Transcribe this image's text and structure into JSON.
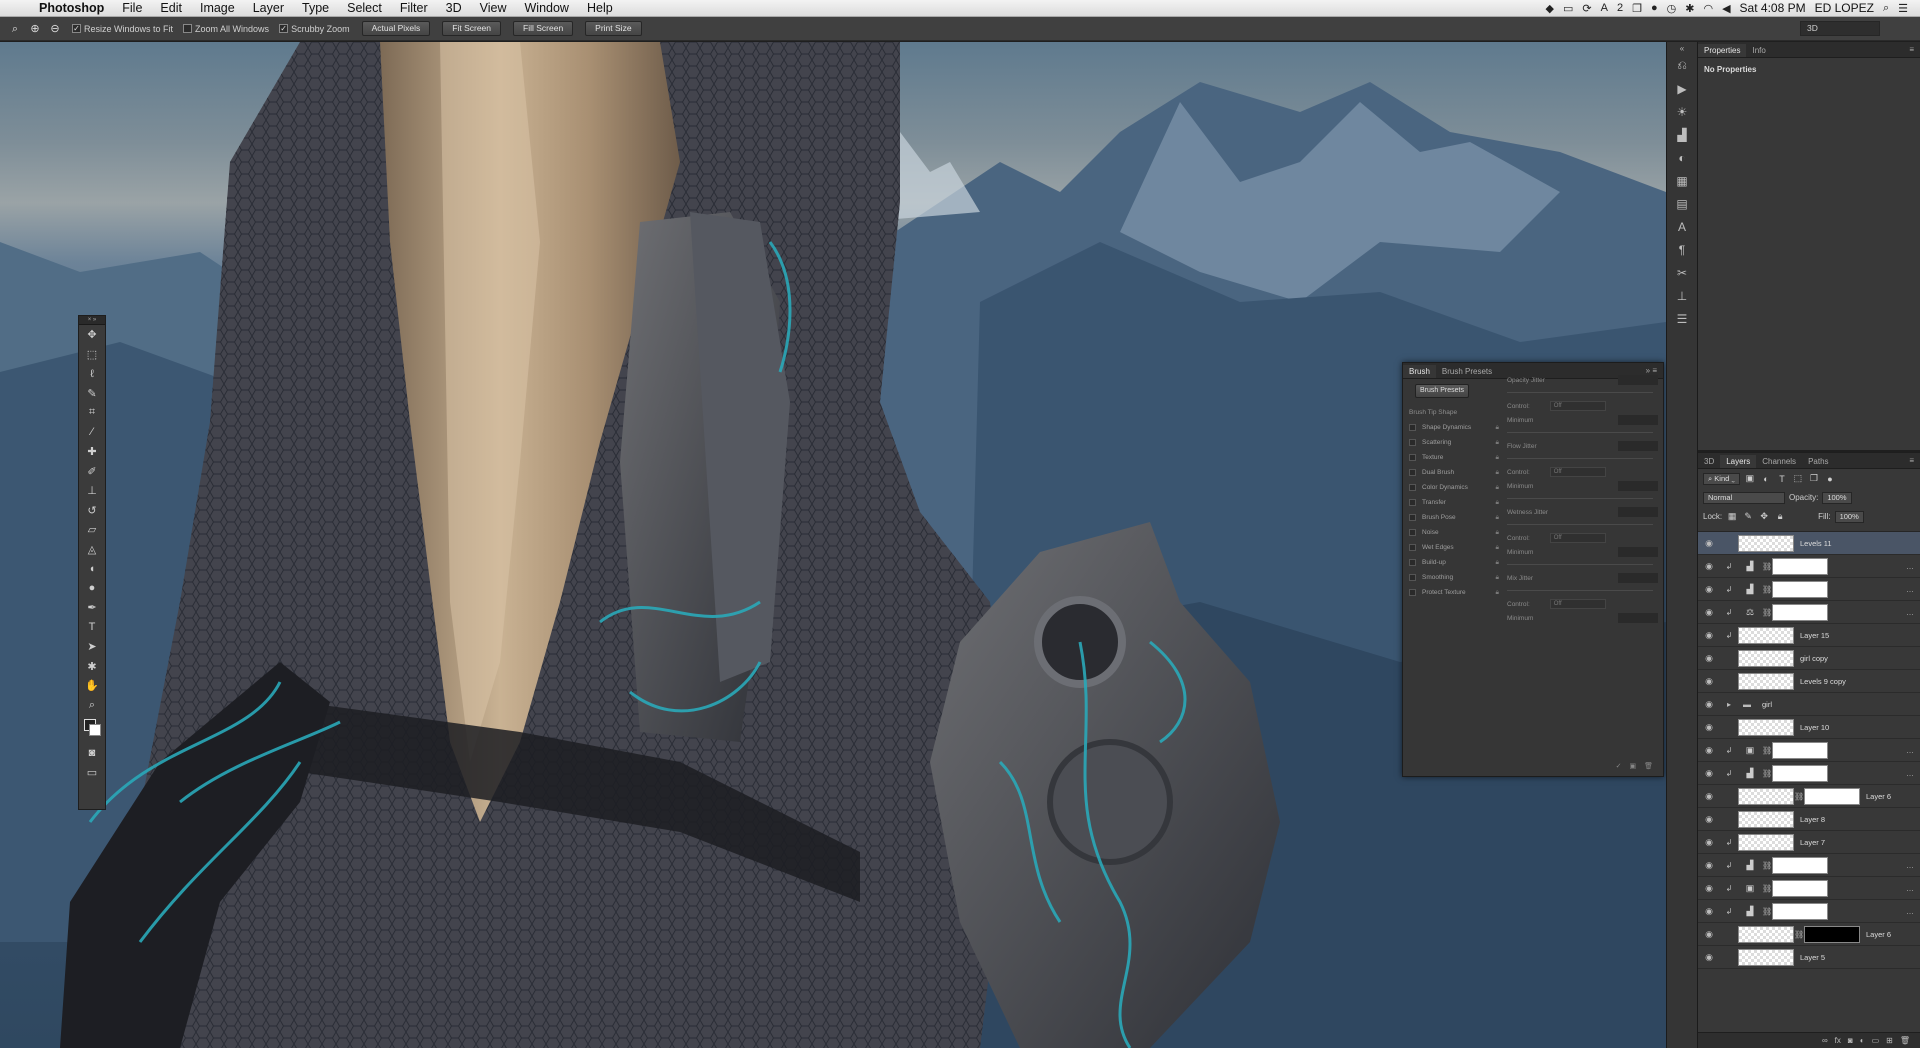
{
  "menubar": {
    "app": "Photoshop",
    "items": [
      "File",
      "Edit",
      "Image",
      "Layer",
      "Type",
      "Select",
      "Filter",
      "3D",
      "View",
      "Window",
      "Help"
    ],
    "tray": {
      "battery_count": "2",
      "clock": "Sat 4:08 PM",
      "user": "ED LOPEZ"
    }
  },
  "options": {
    "resize_windows": "Resize Windows to Fit",
    "zoom_all": "Zoom All Windows",
    "scrubby_zoom": "Scrubby Zoom",
    "buttons": [
      "Actual Pixels",
      "Fit Screen",
      "Fill Screen",
      "Print Size"
    ],
    "workspace": "3D"
  },
  "properties": {
    "tabs": [
      "Properties",
      "Info"
    ],
    "message": "No Properties"
  },
  "layers_panel": {
    "tabs": [
      "3D",
      "Layers",
      "Channels",
      "Paths"
    ],
    "kind": "Kind",
    "blend_mode": "Normal",
    "opacity_label": "Opacity:",
    "opacity": "100%",
    "lock_label": "Lock:",
    "fill_label": "Fill:",
    "fill": "100%",
    "layers": [
      {
        "name": "Levels 11",
        "type": "thumb",
        "selected": true
      },
      {
        "name": "",
        "type": "adj",
        "icon": "levels",
        "clip": true,
        "mask": "Ⅰ"
      },
      {
        "name": "",
        "type": "adj",
        "icon": "levels",
        "clip": true,
        "mask": "╯"
      },
      {
        "name": "",
        "type": "adj",
        "icon": "balance",
        "clip": true,
        "mask": "}"
      },
      {
        "name": "Layer 15",
        "type": "thumb",
        "clip": true
      },
      {
        "name": "girl copy",
        "type": "thumb"
      },
      {
        "name": "Levels 9 copy",
        "type": "thumb"
      },
      {
        "name": "girl",
        "type": "group"
      },
      {
        "name": "Layer 10",
        "type": "thumb"
      },
      {
        "name": "",
        "type": "adj",
        "icon": "photo",
        "clip": true
      },
      {
        "name": "",
        "type": "adj",
        "icon": "levels",
        "clip": true
      },
      {
        "name": "Layer 6",
        "type": "masked"
      },
      {
        "name": "Layer 8",
        "type": "thumb"
      },
      {
        "name": "Layer 7",
        "type": "thumb",
        "clip": true
      },
      {
        "name": "",
        "type": "adj",
        "icon": "levels",
        "clip": true
      },
      {
        "name": "",
        "type": "adj",
        "icon": "photo",
        "clip": true
      },
      {
        "name": "",
        "type": "adj",
        "icon": "levels",
        "clip": true
      },
      {
        "name": "Layer 6",
        "type": "masked-dark"
      },
      {
        "name": "Layer 5",
        "type": "thumb"
      }
    ]
  },
  "brush_panel": {
    "tabs": [
      "Brush",
      "Brush Presets"
    ],
    "presets_button": "Brush Presets",
    "tip_shape": "Brush Tip Shape",
    "options": [
      "Shape Dynamics",
      "Scattering",
      "Texture",
      "Dual Brush",
      "Color Dynamics",
      "Transfer",
      "Brush Pose",
      "Noise",
      "Wet Edges",
      "Build-up",
      "Smoothing",
      "Protect Texture"
    ],
    "right": {
      "opacity_jitter": "Opacity Jitter",
      "control": "Control:",
      "off": "Off",
      "minimum": "Minimum",
      "flow_jitter": "Flow Jitter",
      "wetness_jitter": "Wetness Jitter",
      "mix_jitter": "Mix Jitter"
    }
  },
  "icons": {
    "tools": [
      "move-tool",
      "marquee-tool",
      "lasso-tool",
      "quick-select-tool",
      "crop-tool",
      "eyedropper-tool",
      "healing-brush-tool",
      "brush-tool",
      "clone-stamp-tool",
      "history-brush-tool",
      "eraser-tool",
      "paint-bucket-tool",
      "blur-tool",
      "dodge-tool",
      "pen-tool",
      "type-tool",
      "path-select-tool",
      "shape-tool",
      "hand-tool",
      "zoom-tool"
    ],
    "panel_column": [
      "history",
      "play-actions",
      "adjustments",
      "levels",
      "color",
      "swatches",
      "layers-comp",
      "character",
      "paragraph",
      "tools-presets",
      "clone-source",
      "brush"
    ]
  },
  "colors": {
    "ui_dark": "#383838",
    "selected_layer": "#4a5566",
    "accent_cable": "#2aa8b8"
  }
}
